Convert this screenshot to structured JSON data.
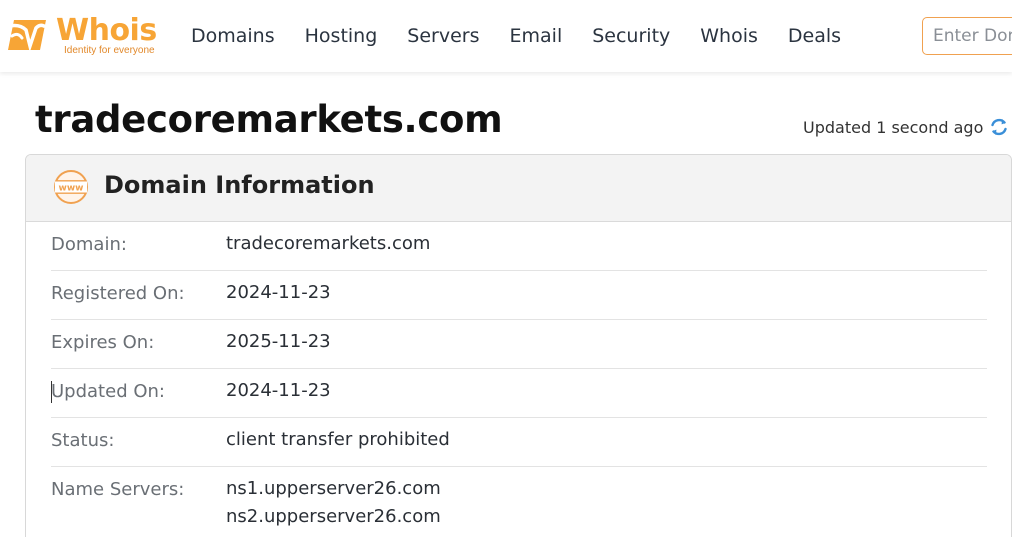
{
  "brand": {
    "name": "Whois",
    "tagline": "Identity for everyone",
    "accent": "#f7a536"
  },
  "nav": {
    "items": [
      {
        "label": "Domains"
      },
      {
        "label": "Hosting"
      },
      {
        "label": "Servers"
      },
      {
        "label": "Email"
      },
      {
        "label": "Security"
      },
      {
        "label": "Whois"
      },
      {
        "label": "Deals"
      }
    ]
  },
  "search": {
    "placeholder": "Enter Domain"
  },
  "page": {
    "domain": "tradecoremarkets.com",
    "updated": "Updated 1 second ago"
  },
  "card": {
    "title": "Domain Information",
    "rows": [
      {
        "label": "Domain:",
        "value": "tradecoremarkets.com"
      },
      {
        "label": "Registered On:",
        "value": "2024-11-23"
      },
      {
        "label": "Expires On:",
        "value": "2025-11-23"
      },
      {
        "label": "Updated On:",
        "value": "2024-11-23"
      },
      {
        "label": "Status:",
        "value": "client transfer prohibited"
      },
      {
        "label": "Name Servers:",
        "values": [
          "ns1.upperserver26.com",
          "ns2.upperserver26.com"
        ]
      }
    ]
  },
  "colors": {
    "icon_blue": "#3a8fd8",
    "icon_orange": "#f0a150"
  },
  "icons": [
    "whois-logo-icon",
    "refresh-icon",
    "www-icon"
  ]
}
